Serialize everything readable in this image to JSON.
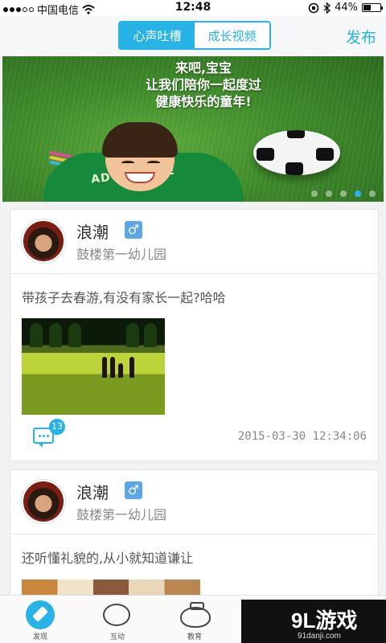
{
  "status_bar": {
    "carrier": "中国电信",
    "time": "12:48",
    "battery_text": "44%",
    "battery_level": 0.44
  },
  "header": {
    "tabs": [
      "心声吐槽",
      "成长视频"
    ],
    "active_tab": 0,
    "publish_label": "发布"
  },
  "banner": {
    "lines": [
      "来吧,宝宝",
      "让我们陪你一起度过",
      "健康快乐的童年!"
    ],
    "shirt_text": "ADVENTURE",
    "pages": 5,
    "current_page": 3
  },
  "posts": [
    {
      "name": "浪潮",
      "gender": "♂",
      "school": "鼓楼第一幼儿园",
      "text": "带孩子去春游,有没有家长一起?哈哈",
      "comment_count": "13",
      "timestamp": "2015-03-30 12:34:06"
    },
    {
      "name": "浪潮",
      "gender": "♂",
      "school": "鼓楼第一幼儿园",
      "text": "还听懂礼貌的,从小就知道谦让"
    }
  ],
  "bottom_nav": {
    "items": [
      {
        "label": "发现",
        "icon": "compass-icon"
      },
      {
        "label": "互动",
        "icon": "chat-bubble-icon"
      },
      {
        "label": "教育",
        "icon": "piggy-bank-icon"
      }
    ]
  },
  "watermark": {
    "main": "9L游戏",
    "sub": "91danji.com"
  },
  "colors": {
    "accent": "#27b3e6",
    "background": "#f1f2f4"
  }
}
